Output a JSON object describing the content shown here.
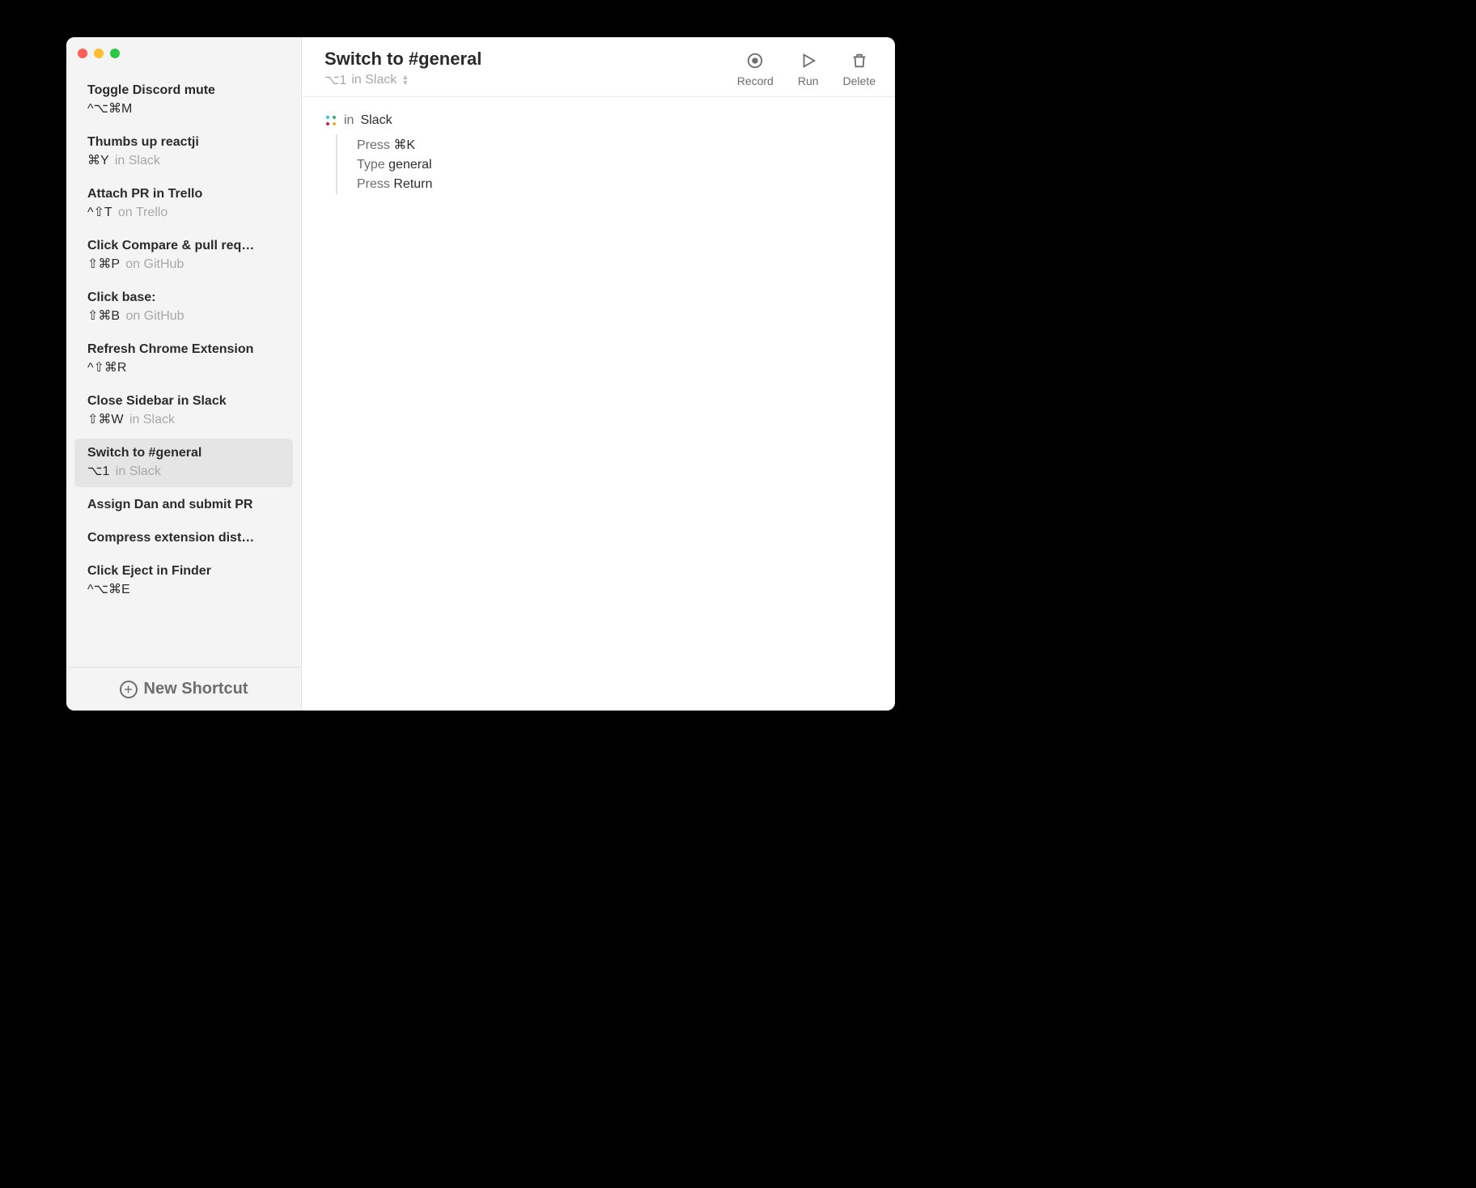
{
  "sidebar": {
    "items": [
      {
        "title": "Toggle Discord mute",
        "shortcut": "^⌥⌘M",
        "context": ""
      },
      {
        "title": "Thumbs up reactji",
        "shortcut": "⌘Y",
        "context": "in Slack"
      },
      {
        "title": "Attach PR in Trello",
        "shortcut": "^⇧T",
        "context": "on Trello"
      },
      {
        "title": "Click Compare & pull req…",
        "shortcut": "⇧⌘P",
        "context": "on GitHub"
      },
      {
        "title": "Click base:",
        "shortcut": "⇧⌘B",
        "context": "on GitHub"
      },
      {
        "title": "Refresh Chrome Extension",
        "shortcut": "^⇧⌘R",
        "context": ""
      },
      {
        "title": "Close Sidebar in Slack",
        "shortcut": "⇧⌘W",
        "context": "in Slack"
      },
      {
        "title": "Switch to #general",
        "shortcut": "⌥1",
        "context": "in Slack"
      },
      {
        "title": "Assign Dan and submit PR",
        "shortcut": "",
        "context": ""
      },
      {
        "title": "Compress extension dist…",
        "shortcut": "",
        "context": ""
      },
      {
        "title": "Click Eject in Finder",
        "shortcut": "^⌥⌘E",
        "context": ""
      }
    ],
    "selected_index": 7,
    "new_shortcut_label": "New Shortcut"
  },
  "header": {
    "title": "Switch to #general",
    "shortcut": "⌥1",
    "context": "in Slack",
    "actions": {
      "record": "Record",
      "run": "Run",
      "delete": "Delete"
    }
  },
  "steps": {
    "context_in": "in",
    "context_app": "Slack",
    "lines": [
      {
        "verb": "Press",
        "arg": "⌘K"
      },
      {
        "verb": "Type",
        "arg": "general"
      },
      {
        "verb": "Press",
        "arg": "Return"
      }
    ]
  }
}
